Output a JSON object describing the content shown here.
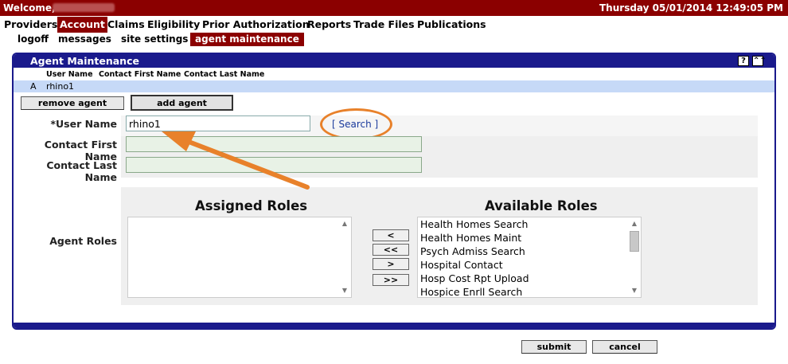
{
  "topbar": {
    "welcome": "Welcome,",
    "datetime": "Thursday 05/01/2014 12:49:05 PM"
  },
  "mainnav": {
    "items": [
      "Providers",
      "Account",
      "Claims",
      "Eligibility",
      "Prior Authorization",
      "Reports",
      "Trade Files",
      "Publications"
    ],
    "active": "Account"
  },
  "subnav": {
    "items": [
      "logoff",
      "messages",
      "site settings",
      "agent maintenance"
    ],
    "active": "agent maintenance"
  },
  "panel": {
    "title": "Agent Maintenance",
    "help_label": "?",
    "collapse_label": "⌃⌃"
  },
  "agents_table": {
    "headers": [
      "User Name",
      "Contact First Name",
      "Contact Last Name"
    ],
    "rows": [
      {
        "status": "A",
        "user_name": "rhino1",
        "first_name": "",
        "last_name": ""
      }
    ]
  },
  "actions": {
    "remove_agent": "remove agent",
    "add_agent": "add agent"
  },
  "form": {
    "user_name_label": "*User Name",
    "user_name_value": "rhino1",
    "search_label": "[ Search ]",
    "first_name_label": "Contact First Name",
    "first_name_value": "",
    "last_name_label": "Contact Last Name",
    "last_name_value": "",
    "agent_roles_label": "Agent Roles"
  },
  "roles": {
    "assigned_title": "Assigned Roles",
    "available_title": "Available Roles",
    "assigned": [],
    "available": [
      "Health Homes Search",
      "Health Homes Maint",
      "Psych Admiss Search",
      "Hospital Contact",
      "Hosp Cost Rpt Upload",
      "Hospice Enrll Search"
    ],
    "move_buttons": [
      "<",
      "<<",
      ">",
      ">>"
    ]
  },
  "footer": {
    "submit": "submit",
    "cancel": "cancel"
  },
  "colors": {
    "brand_red": "#8b0000",
    "panel_blue": "#1a1a8c",
    "highlight_row": "#c6d9f7",
    "annotation_orange": "#e8812a"
  }
}
